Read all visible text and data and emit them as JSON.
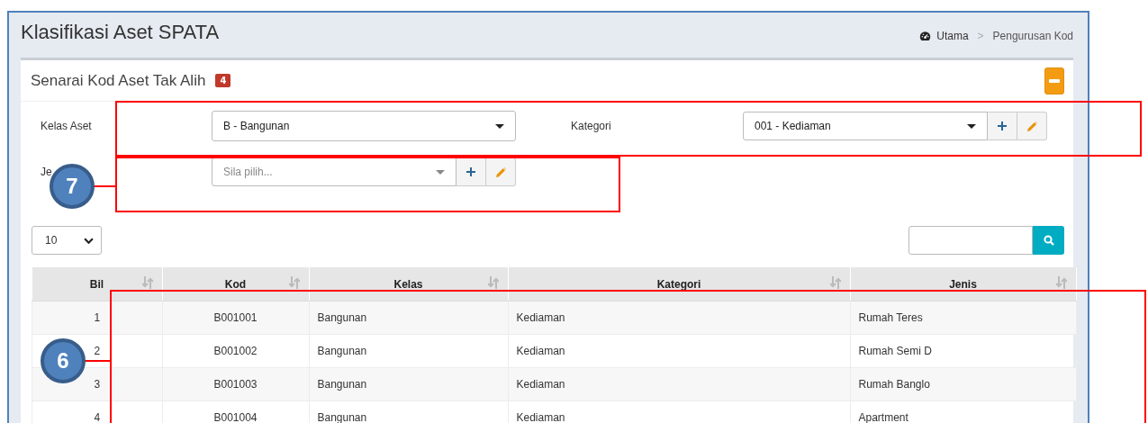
{
  "page": {
    "title": "Klasifikasi Aset SPATA",
    "breadcrumb": {
      "home": "Utama",
      "separator": ">",
      "current": "Pengurusan Kod"
    }
  },
  "card": {
    "title": "Senarai Kod Aset Tak Alih",
    "badge": "4"
  },
  "form": [
    {
      "label": "Kelas Aset",
      "kind": "select",
      "value": "B - Bangunan"
    },
    {
      "label": "Kategori",
      "kind": "select-actions",
      "value": "001 - Kediaman"
    },
    {
      "label": "Je",
      "kind": "select-actions",
      "placeholder": "Sila pilih..."
    }
  ],
  "page_length": "10",
  "table": {
    "columns": [
      "Bil",
      "Kod",
      "Kelas",
      "Kategori",
      "Jenis"
    ],
    "rows": [
      [
        "1",
        "B001001",
        "Bangunan",
        "Kediaman",
        "Rumah Teres"
      ],
      [
        "2",
        "B001002",
        "Bangunan",
        "Kediaman",
        "Rumah Semi D"
      ],
      [
        "3",
        "B001003",
        "Bangunan",
        "Kediaman",
        "Rumah Banglo"
      ],
      [
        "4",
        "B001004",
        "Bangunan",
        "Kediaman",
        "Apartment"
      ]
    ]
  },
  "callouts": [
    {
      "number": "7"
    },
    {
      "number": "6"
    }
  ]
}
